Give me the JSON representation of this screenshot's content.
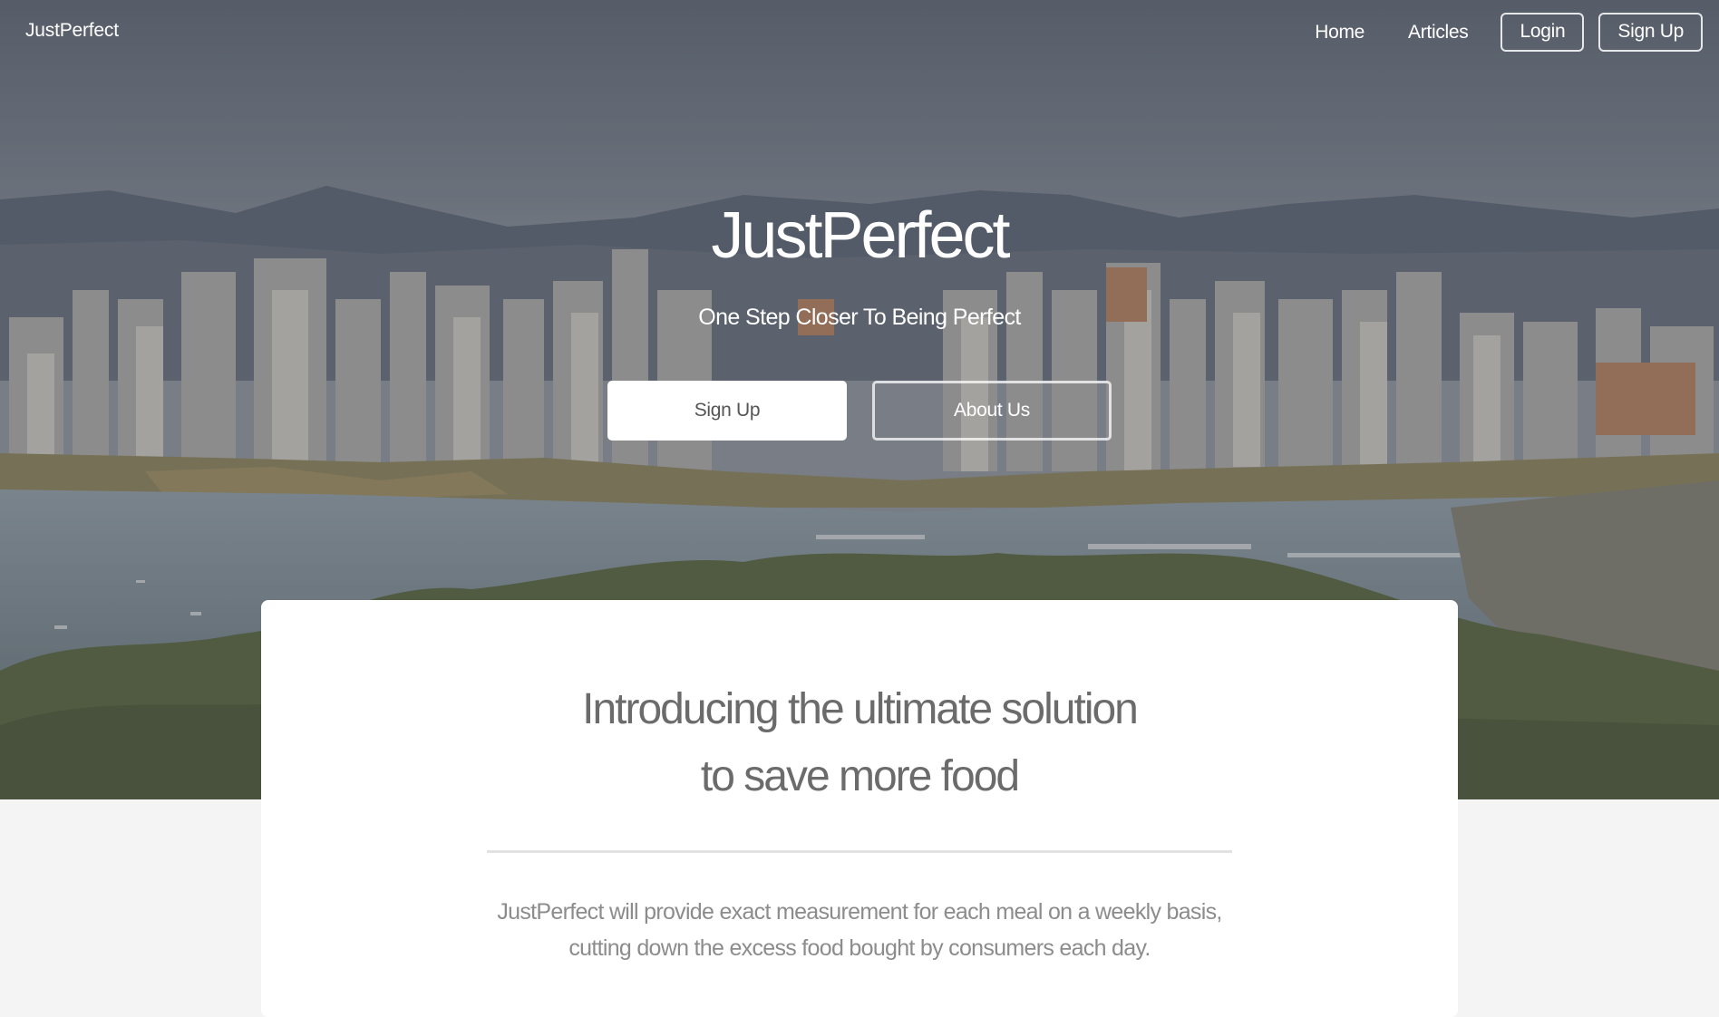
{
  "navbar": {
    "brand": "JustPerfect",
    "links": {
      "home": "Home",
      "articles": "Articles"
    },
    "buttons": {
      "login": "Login",
      "signup": "Sign Up"
    }
  },
  "hero": {
    "title": "JustPerfect",
    "subtitle": "One Step Closer To Being Perfect",
    "primary_button": "Sign Up",
    "secondary_button": "About Us",
    "background_image": "city-skyline-waterfront"
  },
  "intro": {
    "heading_line1": "Introducing the ultimate solution",
    "heading_line2": "to save more food",
    "body_line1": "JustPerfect will provide exact measurement for each meal on a weekly basis,",
    "body_line2": "cutting down the excess food bought by consumers each day."
  },
  "colors": {
    "text_on_hero": "#ffffff",
    "heading_gray": "#6b6b6b",
    "body_gray": "#8c8c8c",
    "page_background": "#f4f4f4"
  }
}
